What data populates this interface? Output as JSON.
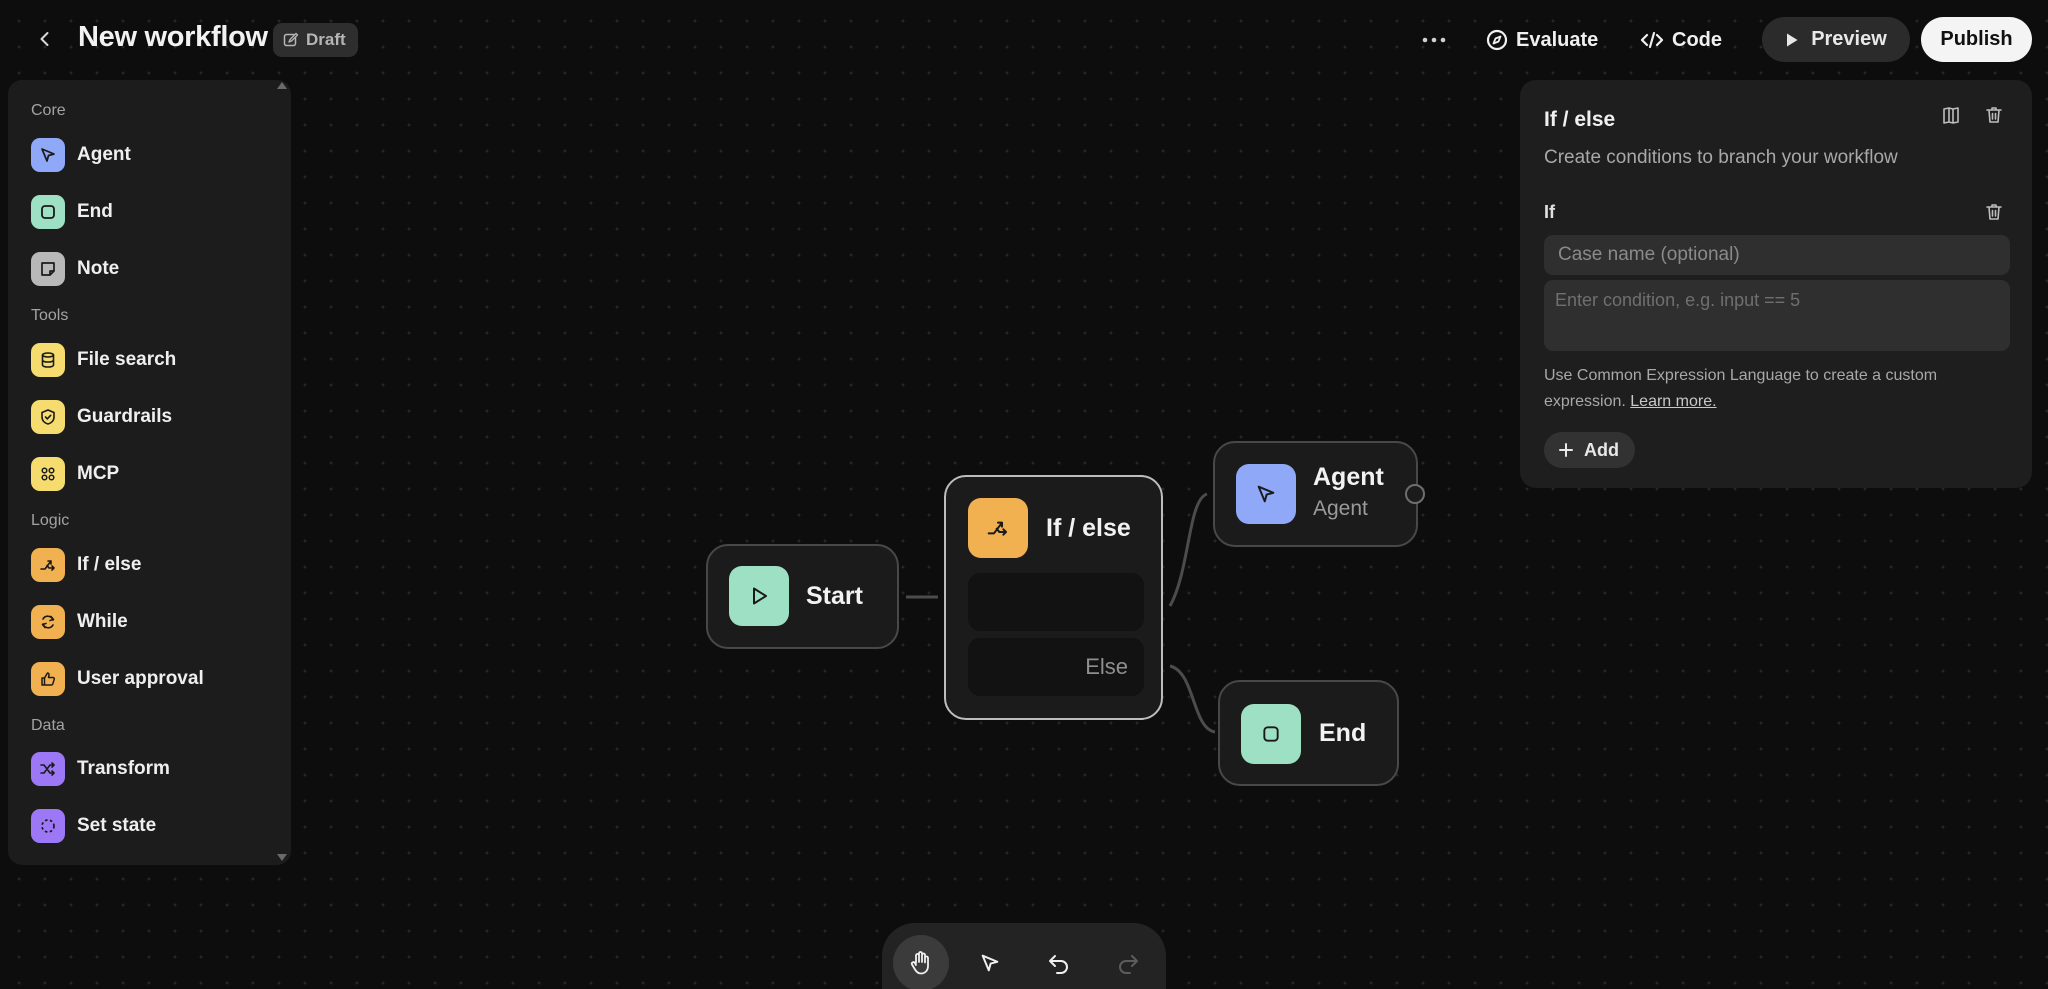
{
  "header": {
    "title": "New workflow",
    "badge": "Draft",
    "evaluate_label": "Evaluate",
    "code_label": "Code",
    "preview_label": "Preview",
    "publish_label": "Publish"
  },
  "palette": {
    "sections": [
      {
        "label": "Core",
        "items": [
          {
            "label": "Agent",
            "icon": "cursor-icon",
            "color": "#8fa8f8"
          },
          {
            "label": "End",
            "icon": "square-icon",
            "color": "#9ee0c3"
          },
          {
            "label": "Note",
            "icon": "note-icon",
            "color": "#b8b8b8"
          }
        ]
      },
      {
        "label": "Tools",
        "items": [
          {
            "label": "File search",
            "icon": "database-icon",
            "color": "#f6dc6e"
          },
          {
            "label": "Guardrails",
            "icon": "shield-icon",
            "color": "#f6dc6e"
          },
          {
            "label": "MCP",
            "icon": "mcp-icon",
            "color": "#f6dc6e"
          }
        ]
      },
      {
        "label": "Logic",
        "items": [
          {
            "label": "If / else",
            "icon": "branch-icon",
            "color": "#f2b151"
          },
          {
            "label": "While",
            "icon": "loop-icon",
            "color": "#f2b151"
          },
          {
            "label": "User approval",
            "icon": "thumbs-icon",
            "color": "#f2b151"
          }
        ]
      },
      {
        "label": "Data",
        "items": [
          {
            "label": "Transform",
            "icon": "shuffle-icon",
            "color": "#9d78f6"
          },
          {
            "label": "Set state",
            "icon": "dashed-circle-icon",
            "color": "#9d78f6"
          }
        ]
      }
    ]
  },
  "canvas": {
    "start": {
      "label": "Start"
    },
    "ifelse": {
      "label": "If / else",
      "else_label": "Else"
    },
    "agent": {
      "label": "Agent",
      "sublabel": "Agent"
    },
    "end": {
      "label": "End"
    }
  },
  "inspector": {
    "title": "If / else",
    "description": "Create conditions to branch your workflow",
    "case_label": "If",
    "case_placeholder": "Case name (optional)",
    "condition_placeholder": "Enter condition, e.g. input == 5",
    "help_text": "Use Common Expression Language to create a custom expression.",
    "help_link": "Learn more.",
    "add_label": "Add"
  },
  "colors": {
    "start": "#9ee0c3",
    "ifelse": "#f2b151",
    "agent": "#8fa8f8",
    "end": "#9ee0c3"
  }
}
